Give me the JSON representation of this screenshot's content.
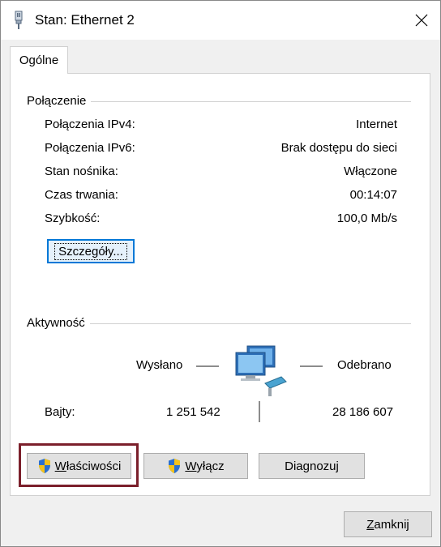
{
  "window": {
    "title": "Stan: Ethernet 2"
  },
  "tab": {
    "label": "Ogólne"
  },
  "connection": {
    "group_label": "Połączenie",
    "rows": [
      {
        "label": "Połączenia IPv4:",
        "value": "Internet"
      },
      {
        "label": "Połączenia IPv6:",
        "value": "Brak dostępu do sieci"
      },
      {
        "label": "Stan nośnika:",
        "value": "Włączone"
      },
      {
        "label": "Czas trwania:",
        "value": "00:14:07"
      },
      {
        "label": "Szybkość:",
        "value": "100,0 Mb/s"
      }
    ],
    "details_button": {
      "pre": "Szcze",
      "accel": "g",
      "post": "óły..."
    }
  },
  "activity": {
    "group_label": "Aktywność",
    "sent_label": "Wysłano",
    "received_label": "Odebrano",
    "bytes_label": "Bajty:",
    "bytes_sent": "1 251 542",
    "bytes_received": "28 186 607"
  },
  "buttons": {
    "properties": {
      "accel": "W",
      "rest": "łaściwości"
    },
    "disable": {
      "accel": "W",
      "rest": "yłącz"
    },
    "diagnose": {
      "label": "Diagnozuj"
    },
    "close": {
      "accel": "Z",
      "rest": "amknij"
    }
  },
  "colors": {
    "highlight": "#7b1f2b",
    "focus": "#0078d7"
  },
  "icons": {
    "title": "network-adapter-icon",
    "activity": "network-computers-icon",
    "uac": "uac-shield-icon"
  }
}
